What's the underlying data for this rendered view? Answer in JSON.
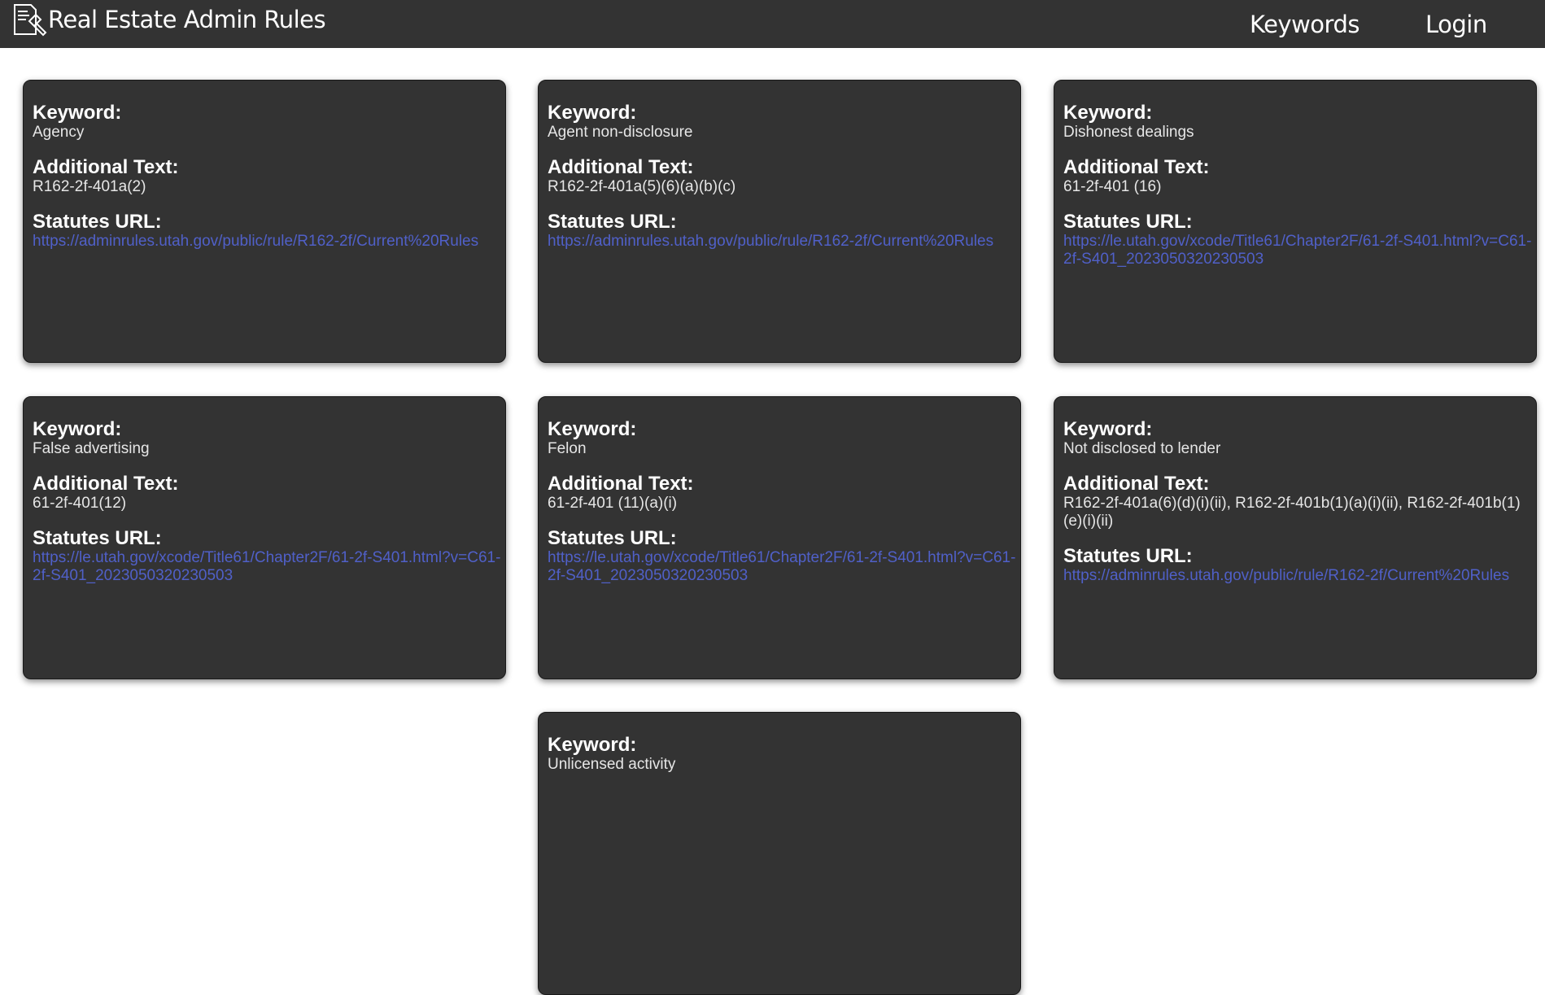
{
  "app": {
    "title": "Real Estate Admin Rules",
    "logo_icon": "gavel-document-icon",
    "nav": {
      "keywords": "Keywords",
      "login": "Login"
    }
  },
  "labels": {
    "keyword": "Keyword:",
    "additional_text": "Additional Text:",
    "statutes_url": "Statutes URL:"
  },
  "cards": [
    {
      "keyword": "Agency",
      "additional_text": "R162-2f-401a(2)",
      "statutes_url": "https://adminrules.utah.gov/public/rule/R162-2f/Current%20Rules"
    },
    {
      "keyword": "Agent non-disclosure",
      "additional_text": "R162-2f-401a(5)(6)(a)(b)(c)",
      "statutes_url": "https://adminrules.utah.gov/public/rule/R162-2f/Current%20Rules"
    },
    {
      "keyword": "Dishonest dealings",
      "additional_text": "61-2f-401 (16)",
      "statutes_url": "https://le.utah.gov/xcode/Title61/Chapter2F/61-2f-S401.html?v=C61-2f-S401_2023050320230503"
    },
    {
      "keyword": "False advertising",
      "additional_text": "61-2f-401(12)",
      "statutes_url": "https://le.utah.gov/xcode/Title61/Chapter2F/61-2f-S401.html?v=C61-2f-S401_2023050320230503"
    },
    {
      "keyword": "Felon",
      "additional_text": "61-2f-401 (11)(a)(i)",
      "statutes_url": "https://le.utah.gov/xcode/Title61/Chapter2F/61-2f-S401.html?v=C61-2f-S401_2023050320230503"
    },
    {
      "keyword": "Not disclosed to lender",
      "additional_text": "R162-2f-401a(6)(d)(i)(ii), R162-2f-401b(1)(a)(i)(ii), R162-2f-401b(1)(e)(i)(ii)",
      "statutes_url": "https://adminrules.utah.gov/public/rule/R162-2f/Current%20Rules"
    },
    {
      "keyword": "Unlicensed activity",
      "additional_text": "",
      "statutes_url": ""
    }
  ],
  "colors": {
    "navbar": "#333333",
    "card": "#333333",
    "link": "#5060c8"
  }
}
